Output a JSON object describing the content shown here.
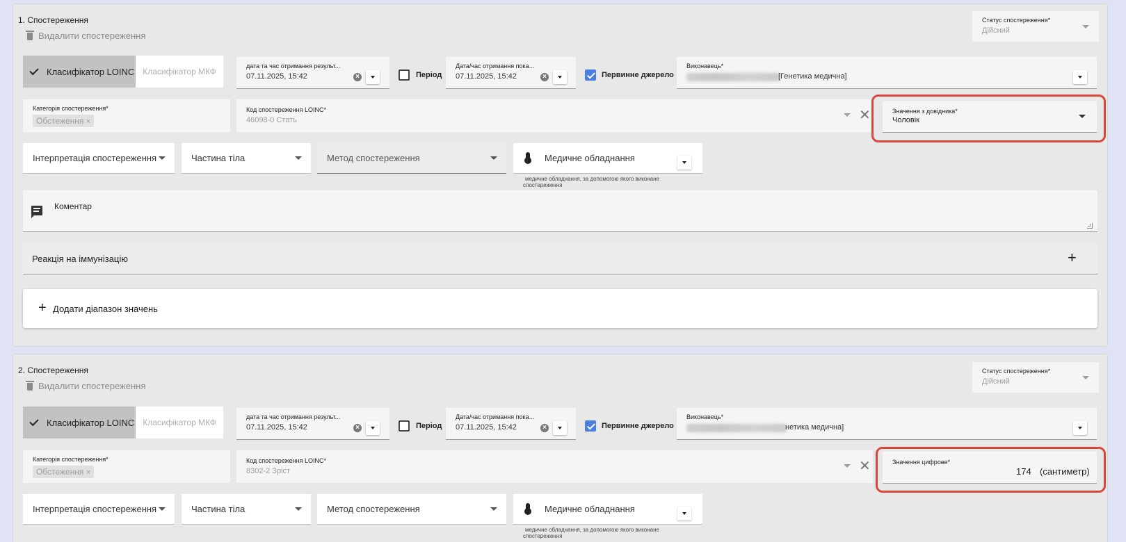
{
  "observations": [
    {
      "title": "1. Спостереження",
      "delete_label": "Видалити спостереження",
      "status": {
        "label": "Статус спостереження*",
        "value": "Дійсний"
      },
      "classifier": {
        "active": "Класифікатор LOINC",
        "inactive": "Класифікатор МКФ"
      },
      "date_result": {
        "label": "дата та час отримання результ...",
        "value": "07.11.2025, 15:42"
      },
      "period_label": "Період",
      "date_show": {
        "label": "Дата/час отримання пока...",
        "value": "07.11.2025, 15:42"
      },
      "primary_source_label": "Первинне джерело",
      "performer": {
        "label": "Виконавець*",
        "value": "[Генетика медична]"
      },
      "category": {
        "label": "Категорія спостереження*",
        "chip": "Обстеження"
      },
      "code": {
        "label": "Код спостереження LOINC*",
        "value": "46098-0  Стать"
      },
      "value_field": {
        "label": "Значення з довідника*",
        "value": "Чоловік"
      },
      "interpretation": "Інтерпретація спостереження",
      "body_part": "Частина тіла",
      "method": "Метод спостереження",
      "device": "Медичне обладнання",
      "device_helper": "медичне обладнання, за допомогою якого виконане спостереження",
      "comment_label": "Коментар",
      "reaction_label": "Реакція на іммунізацію",
      "add_range_label": "Додати діапазон значень"
    },
    {
      "title": "2. Спостереження",
      "delete_label": "Видалити спостереження",
      "status": {
        "label": "Статус спостереження*",
        "value": "Дійсний"
      },
      "classifier": {
        "active": "Класифікатор LOINC",
        "inactive": "Класифікатор МКФ"
      },
      "date_result": {
        "label": "дата та час отримання результ...",
        "value": "07.11.2025, 15:42"
      },
      "period_label": "Період",
      "date_show": {
        "label": "Дата/час отримання пока...",
        "value": "07.11.2025, 15:42"
      },
      "primary_source_label": "Первинне джерело",
      "performer": {
        "label": "Виконавець*",
        "value": "нетика медична]"
      },
      "category": {
        "label": "Категорія спостереження*",
        "chip": "Обстеження"
      },
      "code": {
        "label": "Код спостереження LOINC*",
        "value": "8302-2  Зріст"
      },
      "value_field": {
        "label": "Значення цифрове*",
        "value": "174",
        "unit": "(сантиметр)"
      },
      "interpretation": "Інтерпретація спостереження",
      "body_part": "Частина тіла",
      "method": "Метод спостереження",
      "device": "Медичне обладнання",
      "device_helper": "медичне обладнання, за допомогою якого виконане спостереження"
    }
  ],
  "colors": {
    "highlight": "#d9463a",
    "checkbox": "#4a7fe0",
    "panel": "#e8e8e8"
  }
}
